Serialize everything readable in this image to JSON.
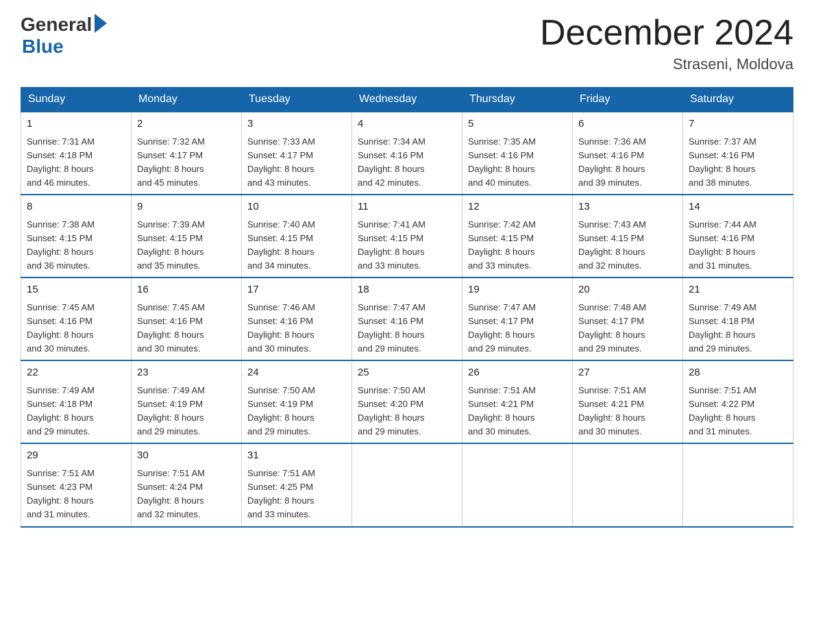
{
  "logo": {
    "general": "General",
    "blue": "Blue"
  },
  "title": "December 2024",
  "location": "Straseni, Moldova",
  "days_of_week": [
    "Sunday",
    "Monday",
    "Tuesday",
    "Wednesday",
    "Thursday",
    "Friday",
    "Saturday"
  ],
  "weeks": [
    [
      {
        "day": "1",
        "sunrise": "7:31 AM",
        "sunset": "4:18 PM",
        "daylight": "8 hours and 46 minutes."
      },
      {
        "day": "2",
        "sunrise": "7:32 AM",
        "sunset": "4:17 PM",
        "daylight": "8 hours and 45 minutes."
      },
      {
        "day": "3",
        "sunrise": "7:33 AM",
        "sunset": "4:17 PM",
        "daylight": "8 hours and 43 minutes."
      },
      {
        "day": "4",
        "sunrise": "7:34 AM",
        "sunset": "4:16 PM",
        "daylight": "8 hours and 42 minutes."
      },
      {
        "day": "5",
        "sunrise": "7:35 AM",
        "sunset": "4:16 PM",
        "daylight": "8 hours and 40 minutes."
      },
      {
        "day": "6",
        "sunrise": "7:36 AM",
        "sunset": "4:16 PM",
        "daylight": "8 hours and 39 minutes."
      },
      {
        "day": "7",
        "sunrise": "7:37 AM",
        "sunset": "4:16 PM",
        "daylight": "8 hours and 38 minutes."
      }
    ],
    [
      {
        "day": "8",
        "sunrise": "7:38 AM",
        "sunset": "4:15 PM",
        "daylight": "8 hours and 36 minutes."
      },
      {
        "day": "9",
        "sunrise": "7:39 AM",
        "sunset": "4:15 PM",
        "daylight": "8 hours and 35 minutes."
      },
      {
        "day": "10",
        "sunrise": "7:40 AM",
        "sunset": "4:15 PM",
        "daylight": "8 hours and 34 minutes."
      },
      {
        "day": "11",
        "sunrise": "7:41 AM",
        "sunset": "4:15 PM",
        "daylight": "8 hours and 33 minutes."
      },
      {
        "day": "12",
        "sunrise": "7:42 AM",
        "sunset": "4:15 PM",
        "daylight": "8 hours and 33 minutes."
      },
      {
        "day": "13",
        "sunrise": "7:43 AM",
        "sunset": "4:15 PM",
        "daylight": "8 hours and 32 minutes."
      },
      {
        "day": "14",
        "sunrise": "7:44 AM",
        "sunset": "4:16 PM",
        "daylight": "8 hours and 31 minutes."
      }
    ],
    [
      {
        "day": "15",
        "sunrise": "7:45 AM",
        "sunset": "4:16 PM",
        "daylight": "8 hours and 30 minutes."
      },
      {
        "day": "16",
        "sunrise": "7:45 AM",
        "sunset": "4:16 PM",
        "daylight": "8 hours and 30 minutes."
      },
      {
        "day": "17",
        "sunrise": "7:46 AM",
        "sunset": "4:16 PM",
        "daylight": "8 hours and 30 minutes."
      },
      {
        "day": "18",
        "sunrise": "7:47 AM",
        "sunset": "4:16 PM",
        "daylight": "8 hours and 29 minutes."
      },
      {
        "day": "19",
        "sunrise": "7:47 AM",
        "sunset": "4:17 PM",
        "daylight": "8 hours and 29 minutes."
      },
      {
        "day": "20",
        "sunrise": "7:48 AM",
        "sunset": "4:17 PM",
        "daylight": "8 hours and 29 minutes."
      },
      {
        "day": "21",
        "sunrise": "7:49 AM",
        "sunset": "4:18 PM",
        "daylight": "8 hours and 29 minutes."
      }
    ],
    [
      {
        "day": "22",
        "sunrise": "7:49 AM",
        "sunset": "4:18 PM",
        "daylight": "8 hours and 29 minutes."
      },
      {
        "day": "23",
        "sunrise": "7:49 AM",
        "sunset": "4:19 PM",
        "daylight": "8 hours and 29 minutes."
      },
      {
        "day": "24",
        "sunrise": "7:50 AM",
        "sunset": "4:19 PM",
        "daylight": "8 hours and 29 minutes."
      },
      {
        "day": "25",
        "sunrise": "7:50 AM",
        "sunset": "4:20 PM",
        "daylight": "8 hours and 29 minutes."
      },
      {
        "day": "26",
        "sunrise": "7:51 AM",
        "sunset": "4:21 PM",
        "daylight": "8 hours and 30 minutes."
      },
      {
        "day": "27",
        "sunrise": "7:51 AM",
        "sunset": "4:21 PM",
        "daylight": "8 hours and 30 minutes."
      },
      {
        "day": "28",
        "sunrise": "7:51 AM",
        "sunset": "4:22 PM",
        "daylight": "8 hours and 31 minutes."
      }
    ],
    [
      {
        "day": "29",
        "sunrise": "7:51 AM",
        "sunset": "4:23 PM",
        "daylight": "8 hours and 31 minutes."
      },
      {
        "day": "30",
        "sunrise": "7:51 AM",
        "sunset": "4:24 PM",
        "daylight": "8 hours and 32 minutes."
      },
      {
        "day": "31",
        "sunrise": "7:51 AM",
        "sunset": "4:25 PM",
        "daylight": "8 hours and 33 minutes."
      },
      null,
      null,
      null,
      null
    ]
  ],
  "labels": {
    "sunrise": "Sunrise:",
    "sunset": "Sunset:",
    "daylight": "Daylight:"
  }
}
